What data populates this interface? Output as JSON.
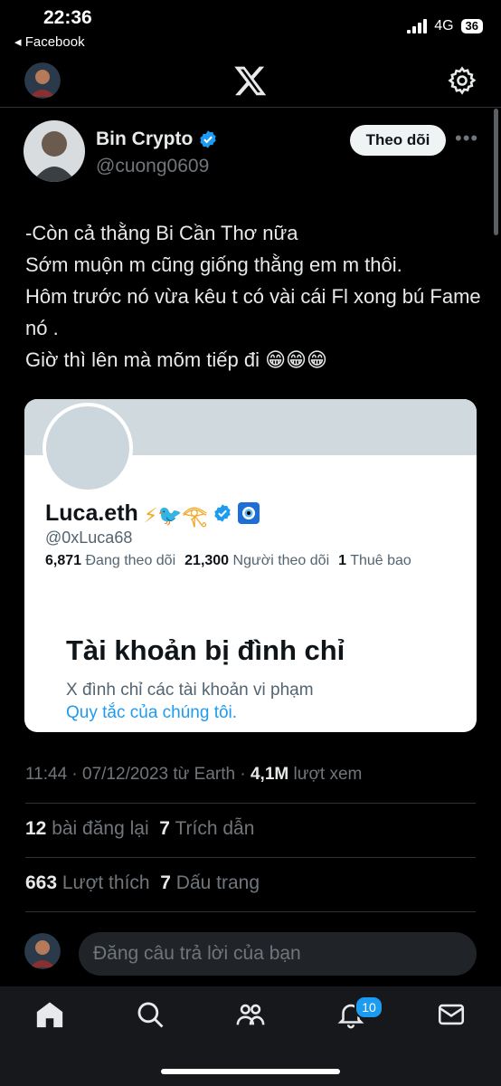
{
  "status": {
    "time": "22:36",
    "back_app": "◂ Facebook",
    "network": "4G",
    "battery": "36"
  },
  "nav": {
    "settings_icon": "gear-icon",
    "logo_icon": "x-logo-icon"
  },
  "tweet": {
    "name": "Bin Crypto",
    "handle": "@cuong0609",
    "follow_label": "Theo dõi",
    "more_label": "•••",
    "text": "-Còn cả thằng Bi Cần Thơ nữa\nSớm muộn m cũng giống thằng em m thôi.\nHôm trước nó vừa kêu t có vài cái Fl xong bú Fame nó .\nGiờ thì lên mà mõm tiếp đi 😁😁😁",
    "embedded": {
      "name": "Luca.eth",
      "name_emojis": "⚡🐦𓂀",
      "handle": "@0xLuca68",
      "following_count": "6,871",
      "following_label": "Đang theo dõi",
      "followers_count": "21,300",
      "followers_label": "Người theo dõi",
      "subs_count": "1",
      "subs_label": "Thuê bao",
      "suspended_title": "Tài khoản bị đình chỉ",
      "suspended_desc": "X đình chỉ các tài khoản vi phạm",
      "rules_link": "Quy tắc của chúng tôi."
    },
    "meta": {
      "time_date": "11:44 · 07/12/2023 từ Earth · ",
      "views": "4,1M",
      "views_label": " lượt xem"
    },
    "reposts": "12",
    "reposts_label": " bài đăng lại  ",
    "quotes": "7",
    "quotes_label": " Trích dẫn",
    "likes": "663",
    "likes_label": " Lượt thích  ",
    "bookmarks": "7",
    "bookmarks_label": " Dấu trang"
  },
  "reply": {
    "placeholder": "Đăng câu trả lời của bạn"
  },
  "bottom_nav": {
    "notification_badge": "10"
  },
  "colors": {
    "accent": "#1d9bf0",
    "background": "#000000"
  }
}
